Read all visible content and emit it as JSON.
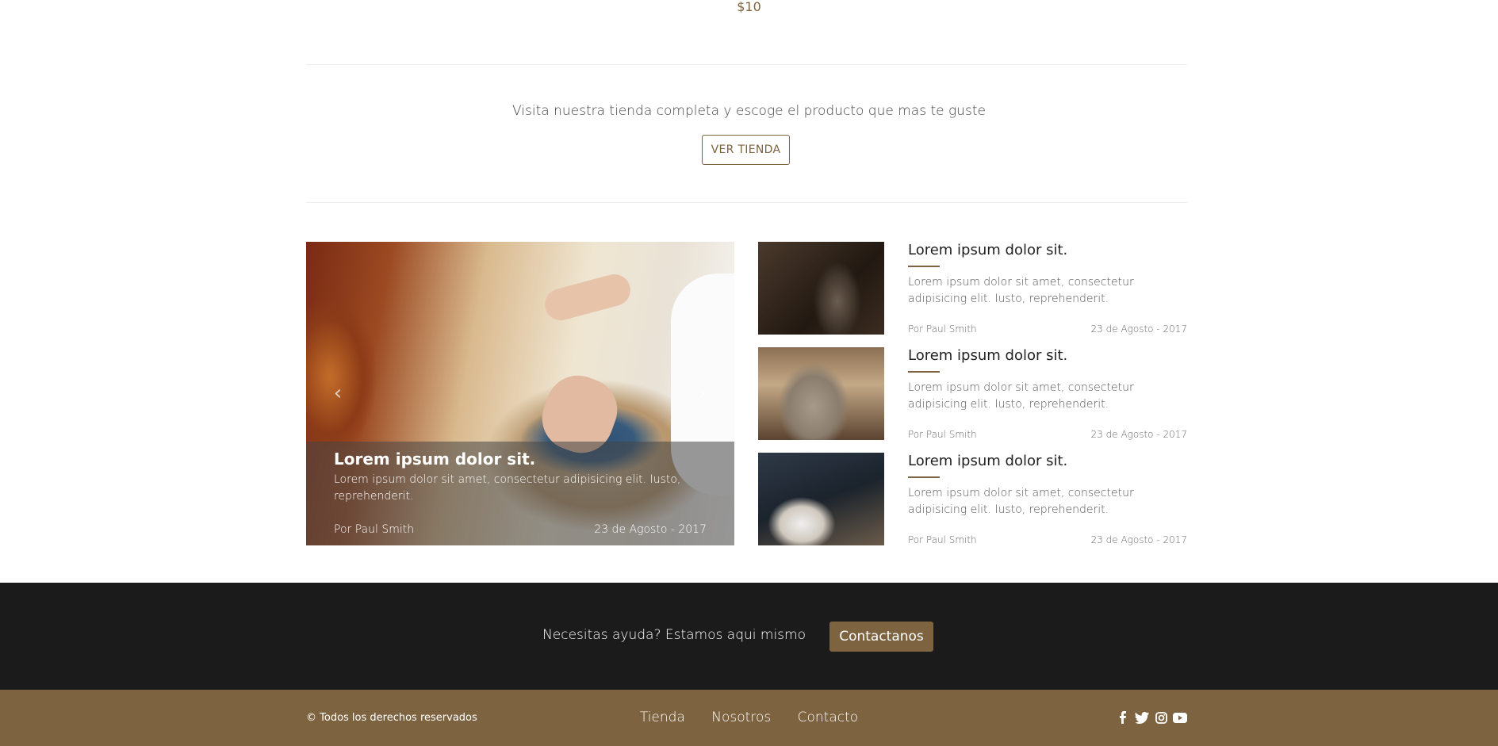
{
  "product": {
    "price": "$10"
  },
  "cta": {
    "text": "Visita nuestra tienda completa y escoge el producto que mas te guste",
    "button": "VER TIENDA"
  },
  "carousel": {
    "title": "Lorem ipsum dolor sit.",
    "text": "Lorem ipsum dolor sit amet, consectetur adipisicing elit. Iusto, reprehenderit.",
    "author": "Por Paul Smith",
    "date": "23 de Agosto - 2017",
    "prev_icon": "chevron-left",
    "next_icon": "chevron-right"
  },
  "articles": [
    {
      "title": "Lorem ipsum dolor sit.",
      "text": "Lorem ipsum dolor sit amet, consectetur adipisicing elit. Iusto, reprehenderit.",
      "author": "Por Paul Smith",
      "date": "23 de Agosto - 2017"
    },
    {
      "title": "Lorem ipsum dolor sit.",
      "text": "Lorem ipsum dolor sit amet, consectetur adipisicing elit. Iusto, reprehenderit.",
      "author": "Por Paul Smith",
      "date": "23 de Agosto - 2017"
    },
    {
      "title": "Lorem ipsum dolor sit.",
      "text": "Lorem ipsum dolor sit amet, consectetur adipisicing elit. Iusto, reprehenderit.",
      "author": "Por Paul Smith",
      "date": "23 de Agosto - 2017"
    }
  ],
  "help": {
    "text": "Necesitas ayuda? Estamos aqui mismo",
    "button": "Contactanos"
  },
  "footer": {
    "copyright": "© Todos los derechos reservados",
    "links": [
      "Tienda",
      "Nosotros",
      "Contacto"
    ],
    "social": [
      "facebook-icon",
      "twitter-icon",
      "instagram-icon",
      "youtube-icon"
    ]
  },
  "colors": {
    "accent": "#7d6340",
    "dark": "#1b1b1b"
  }
}
